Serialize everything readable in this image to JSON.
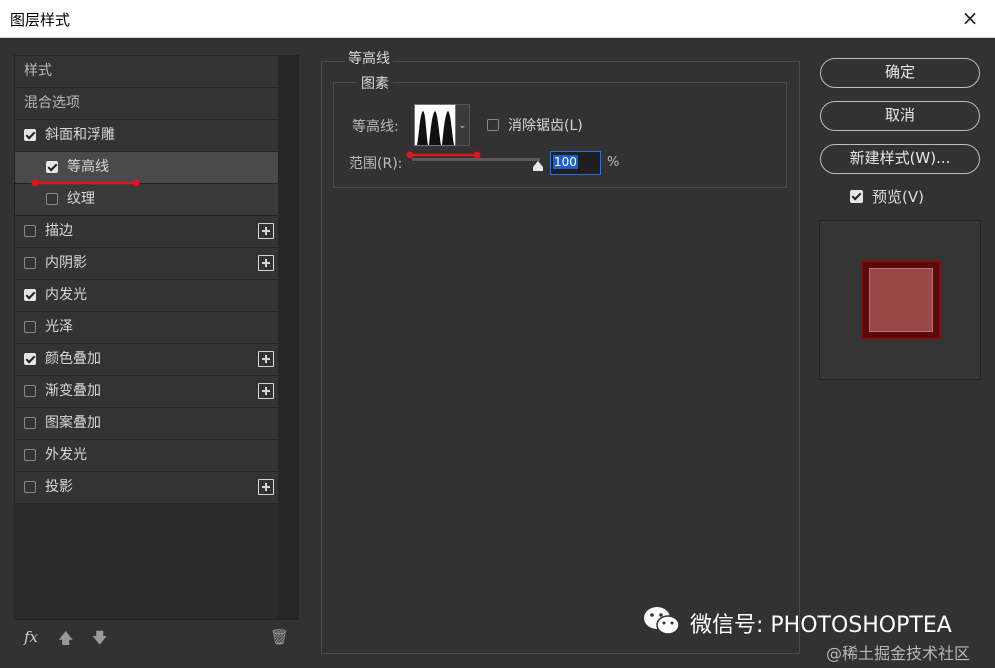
{
  "window": {
    "title": "图层样式",
    "close_icon": "×"
  },
  "left_panel": {
    "items": [
      {
        "label": "样式",
        "type": "section"
      },
      {
        "label": "混合选项",
        "type": "section"
      },
      {
        "label": "斜面和浮雕",
        "checked": true,
        "plus": false
      },
      {
        "label": "等高线",
        "checked": true,
        "sub": true,
        "selected": true
      },
      {
        "label": "纹理",
        "checked": false,
        "sub": true
      },
      {
        "label": "描边",
        "checked": false,
        "plus": true
      },
      {
        "label": "内阴影",
        "checked": false,
        "plus": true
      },
      {
        "label": "内发光",
        "checked": true,
        "plus": false
      },
      {
        "label": "光泽",
        "checked": false,
        "plus": false
      },
      {
        "label": "颜色叠加",
        "checked": true,
        "plus": true
      },
      {
        "label": "渐变叠加",
        "checked": false,
        "plus": true
      },
      {
        "label": "图案叠加",
        "checked": false,
        "plus": false
      },
      {
        "label": "外发光",
        "checked": false,
        "plus": false
      },
      {
        "label": "投影",
        "checked": false,
        "plus": true
      }
    ],
    "bottom": {
      "fx": "fx",
      "up_icon": "🡅",
      "down_icon": "🡇",
      "trash_icon": "🗑"
    }
  },
  "contour_panel": {
    "group_title": "等高线",
    "subgroup_title": "图素",
    "contour_label": "等高线:",
    "anti_alias_label": "消除锯齿(L)",
    "range_label": "范围(R):",
    "range_value": "100",
    "range_unit": "%",
    "range_fraction": 1.0
  },
  "buttons": {
    "ok": "确定",
    "cancel": "取消",
    "new_style": "新建样式(W)..."
  },
  "preview": {
    "label": "预览(V)",
    "checked": true
  },
  "watermark": {
    "text": "微信号: PHOTOSHOPTEA",
    "credit": "@稀土掘金技术社区"
  },
  "colors": {
    "annotation_red": "#e0141c",
    "swatch_dark": "#5a0a0a",
    "swatch_light": "#9a4747"
  }
}
